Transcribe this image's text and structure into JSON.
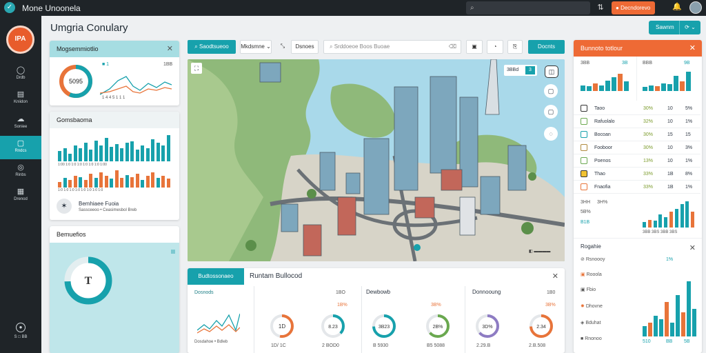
{
  "topbar": {
    "brand_icon": "✓",
    "title": "Mone Unoonela",
    "search_placeholder": "",
    "filter_icon": "⇅",
    "action_label": "Decndorevo",
    "bell_icon": "🔔",
    "colors": {
      "bar": "#1f2428",
      "action": "#ee6a35"
    }
  },
  "sidebar": {
    "logo_text": "IPA",
    "items": [
      {
        "icon": "◯",
        "label": "Drdb",
        "icon_name": "chat-icon"
      },
      {
        "icon": "▤",
        "label": "Kniidon",
        "icon_name": "checklist-icon"
      },
      {
        "icon": "☁",
        "label": "Soniee",
        "icon_name": "cloud-icon"
      },
      {
        "icon": "▢",
        "label": "Rndcs",
        "icon_name": "square-icon"
      },
      {
        "icon": "◎",
        "label": "Rinbs",
        "icon_name": "target-icon"
      },
      {
        "icon": "▦",
        "label": "Drenod",
        "icon_name": "grid-icon"
      }
    ],
    "active_index": 3,
    "bottom_label": "S □ BB"
  },
  "page": {
    "title": "Umgria Conulary",
    "header_button": "Sawnm",
    "header_button_icon": "⟳ ⌄"
  },
  "left_cards": {
    "overview": {
      "title": "Mogsemmiotlio",
      "donut_value": "5095",
      "legend_left": "■ 1",
      "legend_right": "1BB",
      "axis": "1 4 4 5 1 1 1"
    },
    "distribution": {
      "title": "Gomsbaoma",
      "axis_top": "1:00 1:0 1:0 1:0 1:0 1:0 1:0 1:00",
      "axis_bottom": "1:0 1:0 1:0 1:0 1:0 1:0 1:0 1:0",
      "footer_title": "Bemhiaee Fuoia",
      "footer_sub": "Sassceeoo • Ceasimesbol Breb"
    },
    "gauge": {
      "title": "Bemuefios",
      "center": "T"
    }
  },
  "map": {
    "search_button": "Saodtsueoo",
    "dropdown": "Mkdsmne",
    "tool_text": "Dsnoes",
    "search_placeholder": "Srddoeoe Boos Buoae",
    "action_button": "Docnts",
    "zoom_label": "3BBd",
    "zoom_value": "3"
  },
  "bottom_panel": {
    "tabs": [
      "Budtossonaeo",
      "Runtam Bullocod"
    ],
    "left_title": "Dosnods",
    "left_footer": "Dosdahoe • Bdleb",
    "cards": [
      {
        "title": "Bosolstag",
        "corner": "1BO",
        "tag": "1B%",
        "d1": "1D",
        "d2": "8.23",
        "f1": "1D/ 1C",
        "f2": "2 BOD0"
      },
      {
        "title": "Dewbowb",
        "corner": "3B%",
        "tag": "",
        "d1": "3B23",
        "d2": "2B%",
        "f1": "B 5930",
        "f2": "B5 5088"
      },
      {
        "title": "Donnooung",
        "corner": "1B0",
        "tag": "3B%",
        "d1": "3D%",
        "d2": "2.34",
        "f1": "2.29.B",
        "f2": "2.B.508"
      }
    ]
  },
  "right_panel": {
    "title": "Bunnoto totlour",
    "stat1": {
      "label": "3BB",
      "value": "3B"
    },
    "stat2": {
      "label": "BBB",
      "value": "9B"
    },
    "rows": [
      {
        "name": "Taoo",
        "pct": "30%",
        "v1": "10",
        "v2": "5%"
      },
      {
        "name": "Rafuolalo",
        "pct": "32%",
        "v1": "10",
        "v2": "1%"
      },
      {
        "name": "Bocoan",
        "pct": "30%",
        "v1": "15",
        "v2": "15"
      },
      {
        "name": "Fooboor",
        "pct": "30%",
        "v1": "10",
        "v2": "3%"
      },
      {
        "name": "Poenos",
        "pct": "13%",
        "v1": "10",
        "v2": "1%"
      },
      {
        "name": "Thao",
        "pct": "33%",
        "v1": "1B",
        "v2": "8%"
      },
      {
        "name": "Fnaofia",
        "pct": "33%",
        "v1": "1B",
        "v2": "1%"
      }
    ],
    "mid_labels": [
      "3HH",
      "3H%",
      "5B%",
      "B1B"
    ],
    "mid_axis": "3BB 3BS 3BB 3BS",
    "section2_title": "Rogahie",
    "rows2": [
      {
        "name": "Rsnoooy",
        "v": "1%"
      },
      {
        "name": "Rooola",
        "v": ""
      },
      {
        "name": "Fbio",
        "v": ""
      },
      {
        "name": "Dhovne",
        "v": ""
      },
      {
        "name": "Bduhat",
        "v": ""
      },
      {
        "name": "Rnonoo",
        "v": "510"
      }
    ],
    "footer_vals": [
      "BB",
      "5B"
    ]
  }
}
